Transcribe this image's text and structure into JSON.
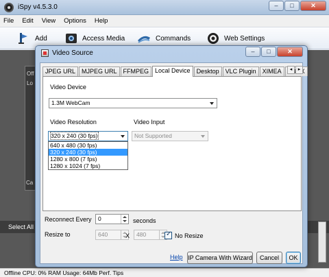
{
  "app": {
    "title": "iSpy v4.5.3.0",
    "window_buttons": [
      "–",
      "□",
      "✕"
    ]
  },
  "menu": [
    "File",
    "Edit",
    "View",
    "Options",
    "Help"
  ],
  "toolbar": {
    "add": "Add",
    "access_media": "Access Media",
    "commands": "Commands",
    "web_settings": "Web Settings"
  },
  "main": {
    "side_text_1": "Off",
    "side_text_2": "Lo",
    "side_text_3": "Ca",
    "select_all": "Select All",
    "status": "Offline   CPU: 0% RAM Usage: 64Mb  Perf. Tips"
  },
  "dialog": {
    "title": "Video Source",
    "window_buttons": [
      "–",
      "□",
      "✕"
    ],
    "tabs": [
      "JPEG URL",
      "MJPEG URL",
      "FFMPEG",
      "Local Device",
      "Desktop",
      "VLC Plugin",
      "XIMEA",
      "XBOX"
    ],
    "active_tab": "Local Device",
    "tab_scroll": [
      "◂",
      "▸"
    ],
    "video_device_label": "Video Device",
    "video_device_value": "1.3M WebCam",
    "video_resolution_label": "Video Resolution",
    "video_resolution_value": "320 x 240 (30 fps)",
    "resolution_options": [
      "640 x 480 (30 fps)",
      "320 x 240 (30 fps)",
      "1280 x 800 (7 fps)",
      "1280 x 1024 (7 fps)"
    ],
    "resolution_selected_index": 1,
    "video_input_label": "Video Input",
    "video_input_value": "Not Supported",
    "reconnect_label": "Reconnect Every",
    "reconnect_value": "0",
    "seconds_label": "seconds",
    "resize_label": "Resize to",
    "resize_width": "640",
    "x_label": "X",
    "resize_height": "480",
    "no_resize_label": "No Resize",
    "no_resize_checked": true,
    "help_link": "Help",
    "wizard_button": "IP Camera With Wizard",
    "cancel_button": "Cancel",
    "ok_button": "OK"
  },
  "colors": {
    "selection": "#3399ff",
    "link": "#0645ad",
    "dialog_frame": "#bad0ea"
  }
}
